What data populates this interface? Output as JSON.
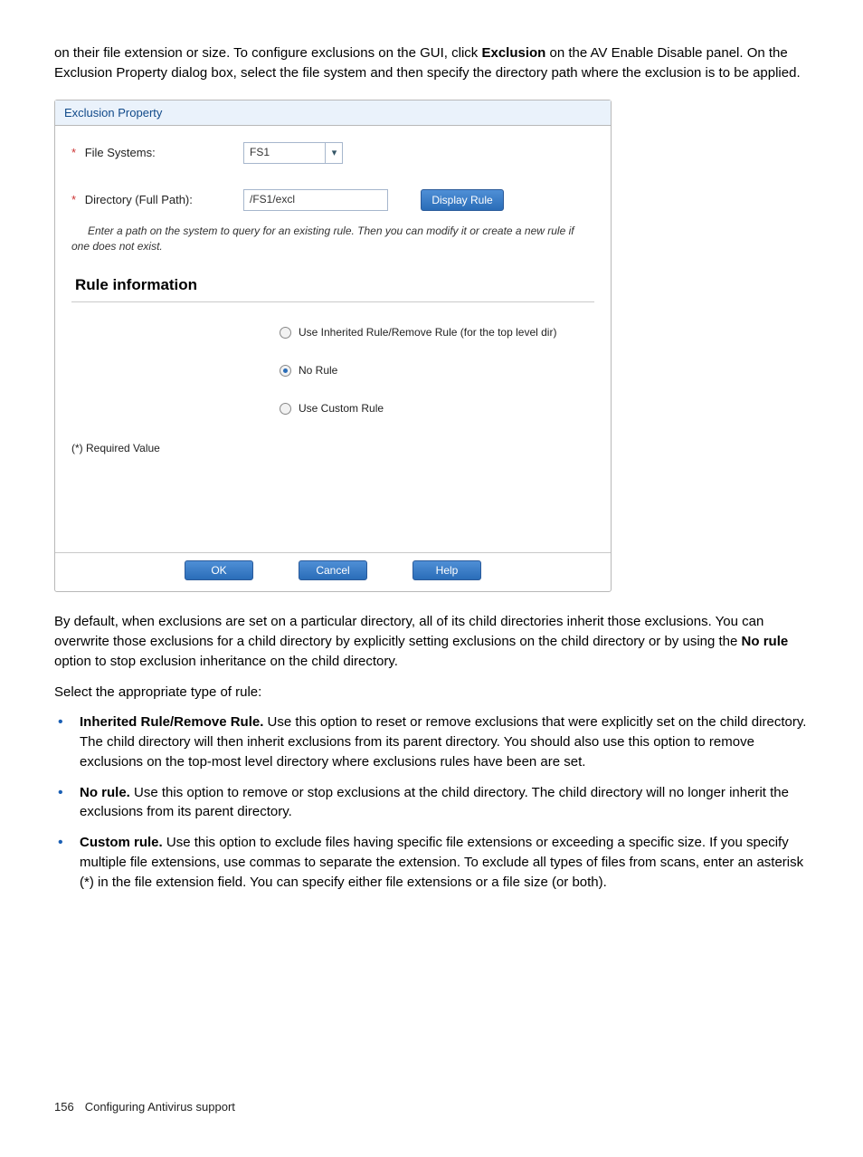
{
  "intro": {
    "text_before_bold": "on their file extension or size. To configure exclusions on the GUI, click ",
    "bold1": "Exclusion",
    "text_after_bold": " on the AV Enable Disable panel. On the Exclusion Property dialog box, select the file system and then specify the directory path where the exclusion is to be applied."
  },
  "dialog": {
    "title": "Exclusion Property",
    "file_systems_label": "File Systems:",
    "file_systems_value": "FS1",
    "directory_label": "Directory (Full Path):",
    "directory_value": "/FS1/excl",
    "display_rule_btn": "Display Rule",
    "help_text_line1": "Enter a path on the system to query for an existing rule. Then you can modify it or create a new rule if",
    "help_text_line2": "one does not exist.",
    "section_header": "Rule information",
    "radio_inherited": "Use Inherited Rule/Remove Rule (for the top level dir)",
    "radio_norule": "No Rule",
    "radio_custom": "Use Custom Rule",
    "required_note": "(*) Required Value",
    "ok_btn": "OK",
    "cancel_btn": "Cancel",
    "help_btn": "Help"
  },
  "body_para": {
    "before_bold": "By default, when exclusions are set on a particular directory, all of its child directories inherit those exclusions. You can overwrite those exclusions for a child directory by explicitly setting exclusions on the child directory or by using the ",
    "bold": "No rule",
    "after_bold": " option to stop exclusion inheritance on the child directory."
  },
  "select_prompt": "Select the appropriate type of rule:",
  "rules": [
    {
      "bold": "Inherited Rule/Remove Rule.",
      "text": " Use this option to reset or remove exclusions that were explicitly set on the child directory. The child directory will then inherit exclusions from its parent directory. You should also use this option to remove exclusions on the top-most level directory where exclusions rules have been are set."
    },
    {
      "bold": "No rule.",
      "text": " Use this option to remove or stop exclusions at the child directory. The child directory will no longer inherit the exclusions from its parent directory."
    },
    {
      "bold": "Custom rule.",
      "text": " Use this option to exclude files having specific file extensions or exceeding a specific size. If you specify multiple file extensions, use commas to separate the extension. To exclude all types of files from scans, enter an asterisk (*) in the file extension field. You can specify either file extensions or a file size (or both)."
    }
  ],
  "footer": {
    "page_num": "156",
    "chapter": "Configuring Antivirus support"
  }
}
